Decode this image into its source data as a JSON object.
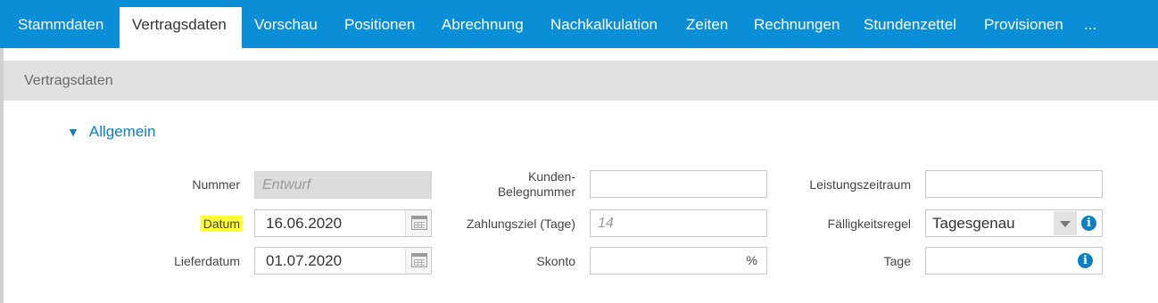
{
  "tabs": [
    {
      "label": "Stammdaten",
      "active": false
    },
    {
      "label": "Vertragsdaten",
      "active": true
    },
    {
      "label": "Vorschau",
      "active": false
    },
    {
      "label": "Positionen",
      "active": false
    },
    {
      "label": "Abrechnung",
      "active": false
    },
    {
      "label": "Nachkalkulation",
      "active": false
    },
    {
      "label": "Zeiten",
      "active": false
    },
    {
      "label": "Rechnungen",
      "active": false
    },
    {
      "label": "Stundenzettel",
      "active": false
    },
    {
      "label": "Provisionen",
      "active": false
    },
    {
      "label": "...",
      "active": false
    }
  ],
  "panel": {
    "title": "Vertragsdaten"
  },
  "section": {
    "toggle_icon": "▼",
    "title": "Allgemein",
    "expanded": true
  },
  "form": {
    "nummer": {
      "label": "Nummer",
      "placeholder": "Entwurf",
      "disabled": true
    },
    "datum": {
      "label": "Datum",
      "value": "16.06.2020",
      "highlighted": true
    },
    "lieferdatum": {
      "label": "Lieferdatum",
      "value": "01.07.2020"
    },
    "kunden_belegnummer": {
      "label_line1": "Kunden-",
      "label_line2": "Belegnummer",
      "value": ""
    },
    "zahlungsziel": {
      "label": "Zahlungsziel (Tage)",
      "placeholder": "14"
    },
    "skonto": {
      "label": "Skonto",
      "value": "",
      "unit": "%"
    },
    "leistungszeitraum": {
      "label": "Leistungszeitraum",
      "value": ""
    },
    "faelligkeitsregel": {
      "label": "Fälligkeitsregel",
      "value": "Tagesgenau"
    },
    "tage": {
      "label": "Tage",
      "value": ""
    }
  },
  "colors": {
    "accent": "#0a8fd6",
    "link": "#0a7fc4",
    "highlight": "#ffff33",
    "panel_header": "#e1e1e1"
  },
  "icons": {
    "calendar": "calendar-icon",
    "info": "info-icon",
    "dropdown": "chevron-down-icon"
  }
}
